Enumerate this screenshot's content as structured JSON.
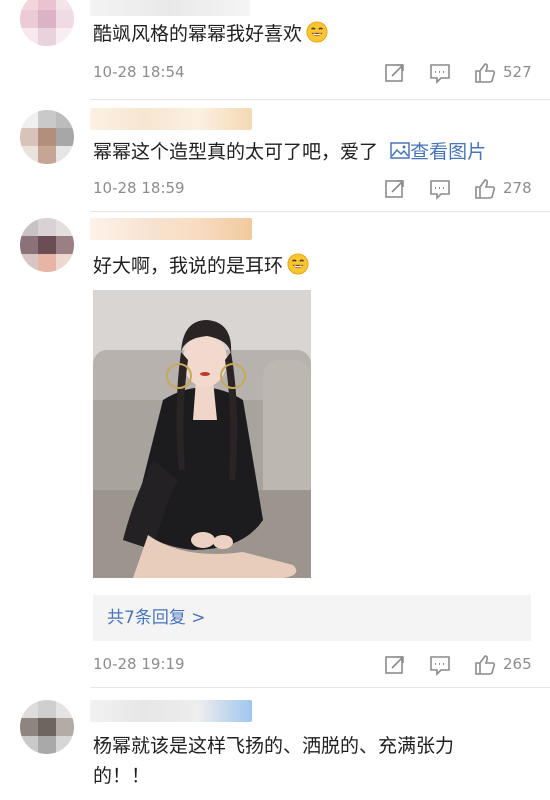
{
  "comments": [
    {
      "text": "酷飒风格的幂幂我好喜欢",
      "time": "10-28 18:54",
      "likes": "527"
    },
    {
      "text": "幂幂这个造型真的太可了吧，爱了",
      "link_text": "查看图片",
      "time": "10-28 18:59",
      "likes": "278"
    },
    {
      "text": "好大啊，我说的是耳环",
      "replies_text": "共7条回复 >",
      "time": "10-28 19:19",
      "likes": "265"
    },
    {
      "text_line1": "杨幂就该是这样飞扬的、洒脱的、充满张力",
      "text_line2": "的！！"
    }
  ],
  "icons": {
    "share": "share-icon",
    "comment": "comment-icon",
    "like": "thumb-up-icon",
    "emoji": "smiling-face-emoji-icon",
    "image": "image-icon"
  },
  "colors": {
    "link": "#4a74b8",
    "meta": "#8c8c8c",
    "reply_bg": "#f4f4f4"
  }
}
